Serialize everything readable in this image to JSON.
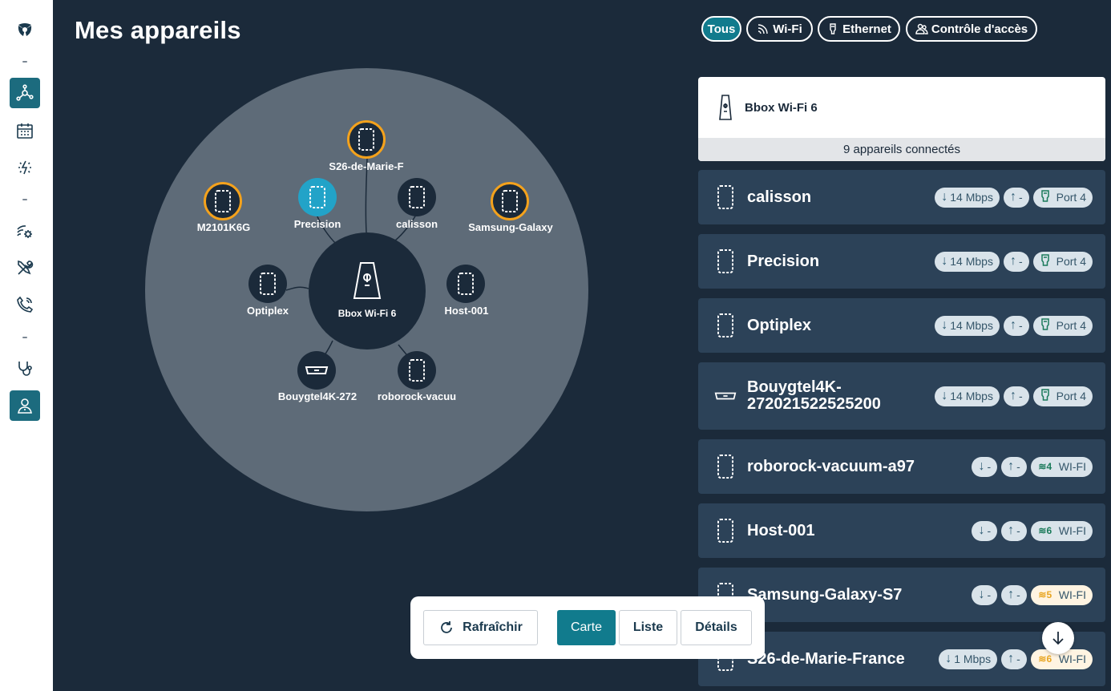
{
  "title": "Mes appareils",
  "filters": [
    "Tous",
    "Wi-Fi",
    "Ethernet",
    "Contrôle d'accès"
  ],
  "map": {
    "hub_label": "Bbox Wi-Fi 6",
    "nodes": [
      "S26-de-Marie-F",
      "M2101K6G",
      "Precision",
      "calisson",
      "Samsung-Galaxy",
      "Optiplex",
      "Host-001",
      "Bouygtel4K-272",
      "roborock-vacuu"
    ]
  },
  "box": {
    "name": "Bbox Wi-Fi 6",
    "connected": "9 appareils connectés"
  },
  "devices": [
    {
      "name": "calisson",
      "down": "14 Mbps",
      "up": "-",
      "link": "Port 4",
      "type": "ethernet"
    },
    {
      "name": "Precision",
      "down": "14 Mbps",
      "up": "-",
      "link": "Port 4",
      "type": "ethernet"
    },
    {
      "name": "Optiplex",
      "down": "14 Mbps",
      "up": "-",
      "link": "Port 4",
      "type": "ethernet"
    },
    {
      "name": "Bouygtel4K-\n272021522525200",
      "down": "14 Mbps",
      "up": "-",
      "link": "Port 4",
      "type": "ethernet"
    },
    {
      "name": "roborock-vacuum-a97",
      "down": "-",
      "up": "-",
      "link": "WI-FI",
      "band": "4",
      "type": "wifi"
    },
    {
      "name": "Host-001",
      "down": "-",
      "up": "-",
      "link": "WI-FI",
      "band": "6",
      "type": "wifi"
    },
    {
      "name": "Samsung-Galaxy-S7",
      "down": "-",
      "up": "-",
      "link": "WI-FI",
      "band": "5",
      "type": "wifi-warn"
    },
    {
      "name": "S26-de-Marie-France",
      "down": "1 Mbps",
      "up": "-",
      "link": "WI-FI",
      "band": "6",
      "type": "wifi-warn"
    }
  ],
  "toolbar": {
    "refresh": "Rafraîchir",
    "map": "Carte",
    "list": "Liste",
    "details": "Détails"
  },
  "colors": {
    "background": "#1b2a3a",
    "accent": "#117b8d",
    "warning": "#f4a21c",
    "row": "#2c4258"
  }
}
